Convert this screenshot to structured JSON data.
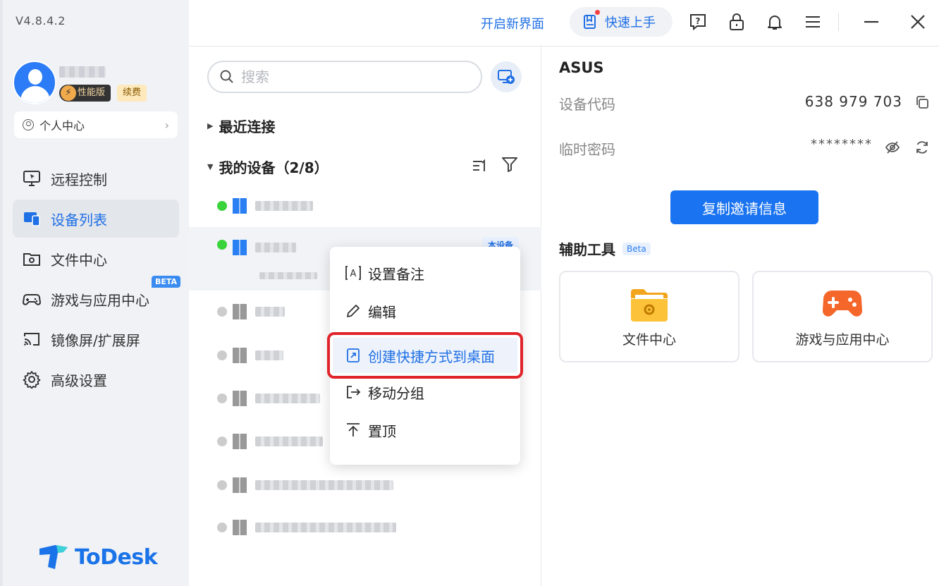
{
  "app": {
    "version": "V4.8.4.2",
    "brand": "ToDesk",
    "accent": "#1a73f0"
  },
  "user": {
    "badge_perf": "性能版",
    "badge_renew": "续费",
    "personal_center": "个人中心"
  },
  "nav": {
    "items": [
      {
        "label": "远程控制",
        "icon": "monitor-cursor-icon"
      },
      {
        "label": "设备列表",
        "icon": "devices-icon"
      },
      {
        "label": "文件中心",
        "icon": "folder-gear-icon"
      },
      {
        "label": "游戏与应用中心",
        "icon": "gamepad-icon",
        "tag": "BETA"
      },
      {
        "label": "镜像屏/扩展屏",
        "icon": "cast-icon"
      },
      {
        "label": "高级设置",
        "icon": "gear-icon"
      }
    ]
  },
  "header": {
    "new_ui": "开启新界面",
    "quick_start": "快速上手"
  },
  "device_list": {
    "search_placeholder": "搜索",
    "recent_group": "最近连接",
    "my_devices_group": "我的设备（2/8）",
    "this_device_tag": "本设备"
  },
  "context_menu": {
    "items": [
      {
        "label": "设置备注",
        "icon": "note-icon"
      },
      {
        "label": "编辑",
        "icon": "pencil-icon"
      },
      {
        "label": "创建快捷方式到桌面",
        "icon": "shortcut-icon"
      },
      {
        "label": "移动分组",
        "icon": "move-group-icon"
      },
      {
        "label": "置顶",
        "icon": "pin-top-icon"
      }
    ]
  },
  "detail": {
    "device_name": "ASUS",
    "device_code_label": "设备代码",
    "device_code": "638 979 703",
    "temp_password_label": "临时密码",
    "temp_password": "********",
    "copy_invite": "复制邀请信息",
    "tools_title": "辅助工具",
    "tools_beta": "Beta",
    "tools": [
      {
        "label": "文件中心",
        "icon": "folder-icon"
      },
      {
        "label": "游戏与应用中心",
        "icon": "gamepad-orange-icon"
      }
    ]
  }
}
